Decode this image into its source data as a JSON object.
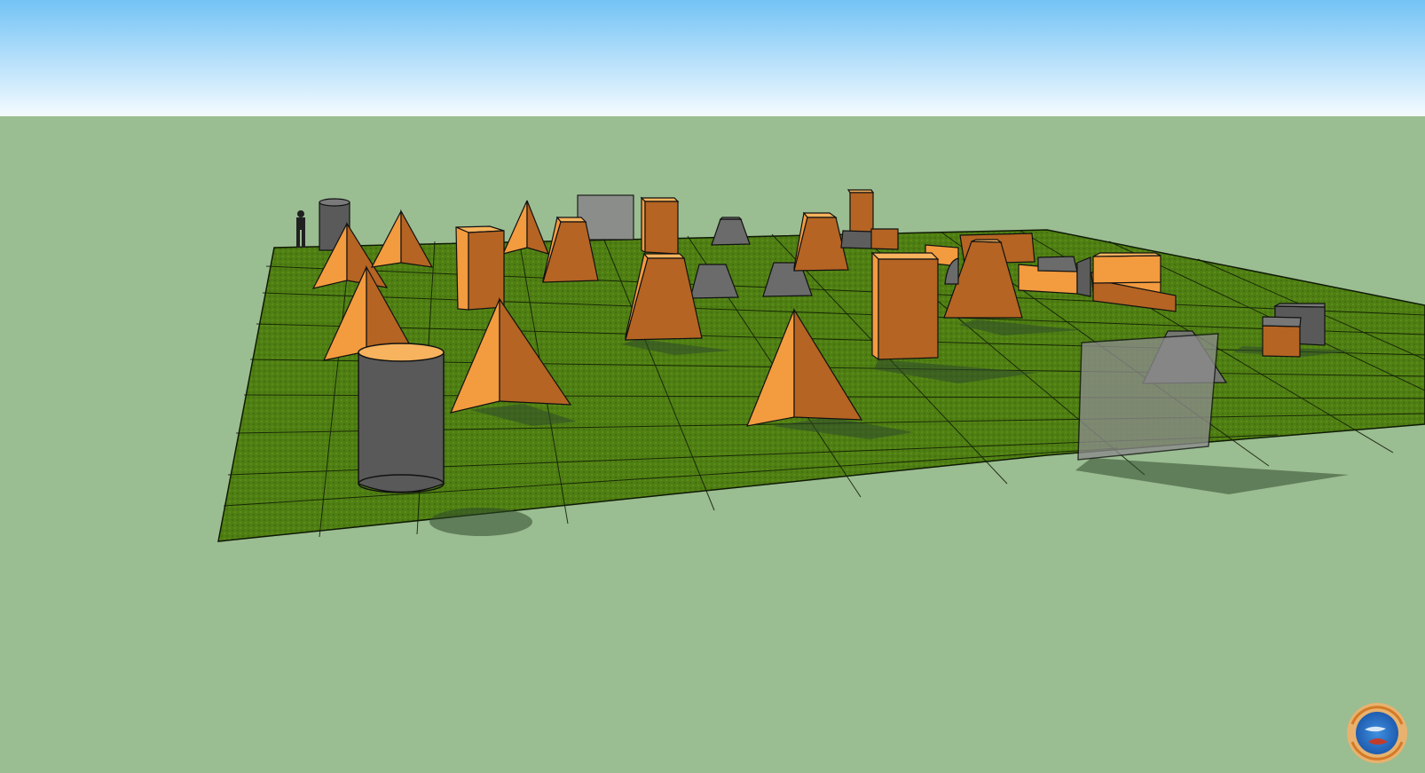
{
  "scene": {
    "view": "3D field layout",
    "colors": {
      "sky_top": "#7ec7f6",
      "sky_bottom": "#ffffff",
      "ground": "#9bbd92",
      "field": "#4f7f13",
      "orange_obstacle": "#f0953b",
      "gray_obstacle": "#6c6c6c",
      "glass_panel": "#8a8a8a"
    }
  },
  "watermark": {
    "icon": "round-logo-with-globe-and-curved-text",
    "text": ""
  }
}
